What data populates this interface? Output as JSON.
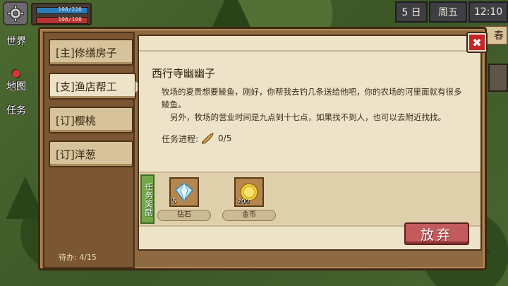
{
  "hud": {
    "mp": "198/220",
    "hp": "100/100",
    "day": "5 日",
    "weekday": "周五",
    "time": "12:10",
    "season": "春"
  },
  "side_menu": {
    "world": "世界",
    "map": "地图",
    "tasks": "任务"
  },
  "tabs": [
    {
      "label": "[主]修缮房子"
    },
    {
      "label": "[支]渔店帮工"
    },
    {
      "label": "[订]樱桃"
    },
    {
      "label": "[订]洋葱"
    }
  ],
  "pending": "待办:  4/15",
  "quest": {
    "giver": "西行寺幽幽子",
    "desc1": "牧场的夏贵想要鲮鱼，刚好，你帮我去钓几条送给他吧，你的农场的河里面就有很多鲮鱼。",
    "desc2": "另外，牧场的营业时间是九点到十七点，如果找不到人，也可以去附近找找。",
    "progress_label": "任务进程:",
    "progress_value": "0/5"
  },
  "rewards": {
    "tag": "任务奖励",
    "items": [
      {
        "name": "钻石",
        "qty": "5",
        "icon": "diamond-icon"
      },
      {
        "name": "金币",
        "qty": "200",
        "icon": "gold-coin-icon"
      }
    ]
  },
  "buttons": {
    "give_up": "放弃",
    "close": "✖"
  },
  "colors": {
    "panel": "#ede3c8",
    "frame": "#8e6a42",
    "give_up": "#c25b5b",
    "close": "#c62626",
    "reward_tag": "#74a84b"
  }
}
